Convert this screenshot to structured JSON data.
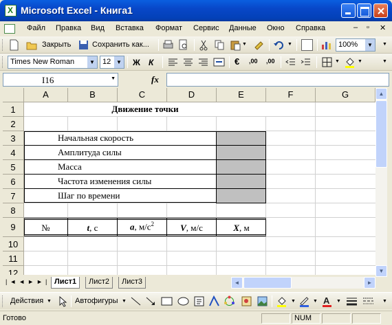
{
  "window": {
    "title": "Microsoft Excel - Книга1"
  },
  "menu": [
    "Файл",
    "Правка",
    "Вид",
    "Вставка",
    "Формат",
    "Сервис",
    "Данные",
    "Окно",
    "Справка"
  ],
  "toolbar_standard": {
    "close_label": "Закрыть",
    "save_label": "Сохранить как...",
    "zoom": "100%"
  },
  "toolbar_format": {
    "font": "Times New Roman",
    "size": "12",
    "bold": "Ж",
    "italic": "К",
    "euro": "€",
    "inc_dec": ",00",
    "dec_dec": ",00"
  },
  "formula_bar": {
    "name_box": "I16",
    "fx": "fx",
    "value": ""
  },
  "columns": [
    "A",
    "B",
    "C",
    "D",
    "E",
    "F",
    "G"
  ],
  "rows": [
    "1",
    "2",
    "3",
    "4",
    "5",
    "6",
    "7",
    "8",
    "9",
    "10",
    "11",
    "12"
  ],
  "cells": {
    "title": "Движение точки",
    "param1": "Начальная скорость",
    "param2": "Амплитуда силы",
    "param3": "Масса",
    "param4": "Частота изменения силы",
    "param5": "Шаг по времени",
    "hdr_no": "№",
    "hdr_t_sym": "t",
    "hdr_t_unit": ", с",
    "hdr_a_sym": "a",
    "hdr_a_unit": ", м/с",
    "hdr_a_sup": "2",
    "hdr_v_sym": "V",
    "hdr_v_unit": ", м/с",
    "hdr_x_sym": "X",
    "hdr_x_unit": ", м"
  },
  "sheets": [
    "Лист1",
    "Лист2",
    "Лист3"
  ],
  "drawing": {
    "actions": "Действия",
    "autoshapes": "Автофигуры"
  },
  "status": {
    "left": "Готово",
    "num": "NUM"
  },
  "colors": {
    "title_bar": "#0a5fe0",
    "gray_input": "#c0c0c0",
    "chrome": "#ece9d8"
  }
}
